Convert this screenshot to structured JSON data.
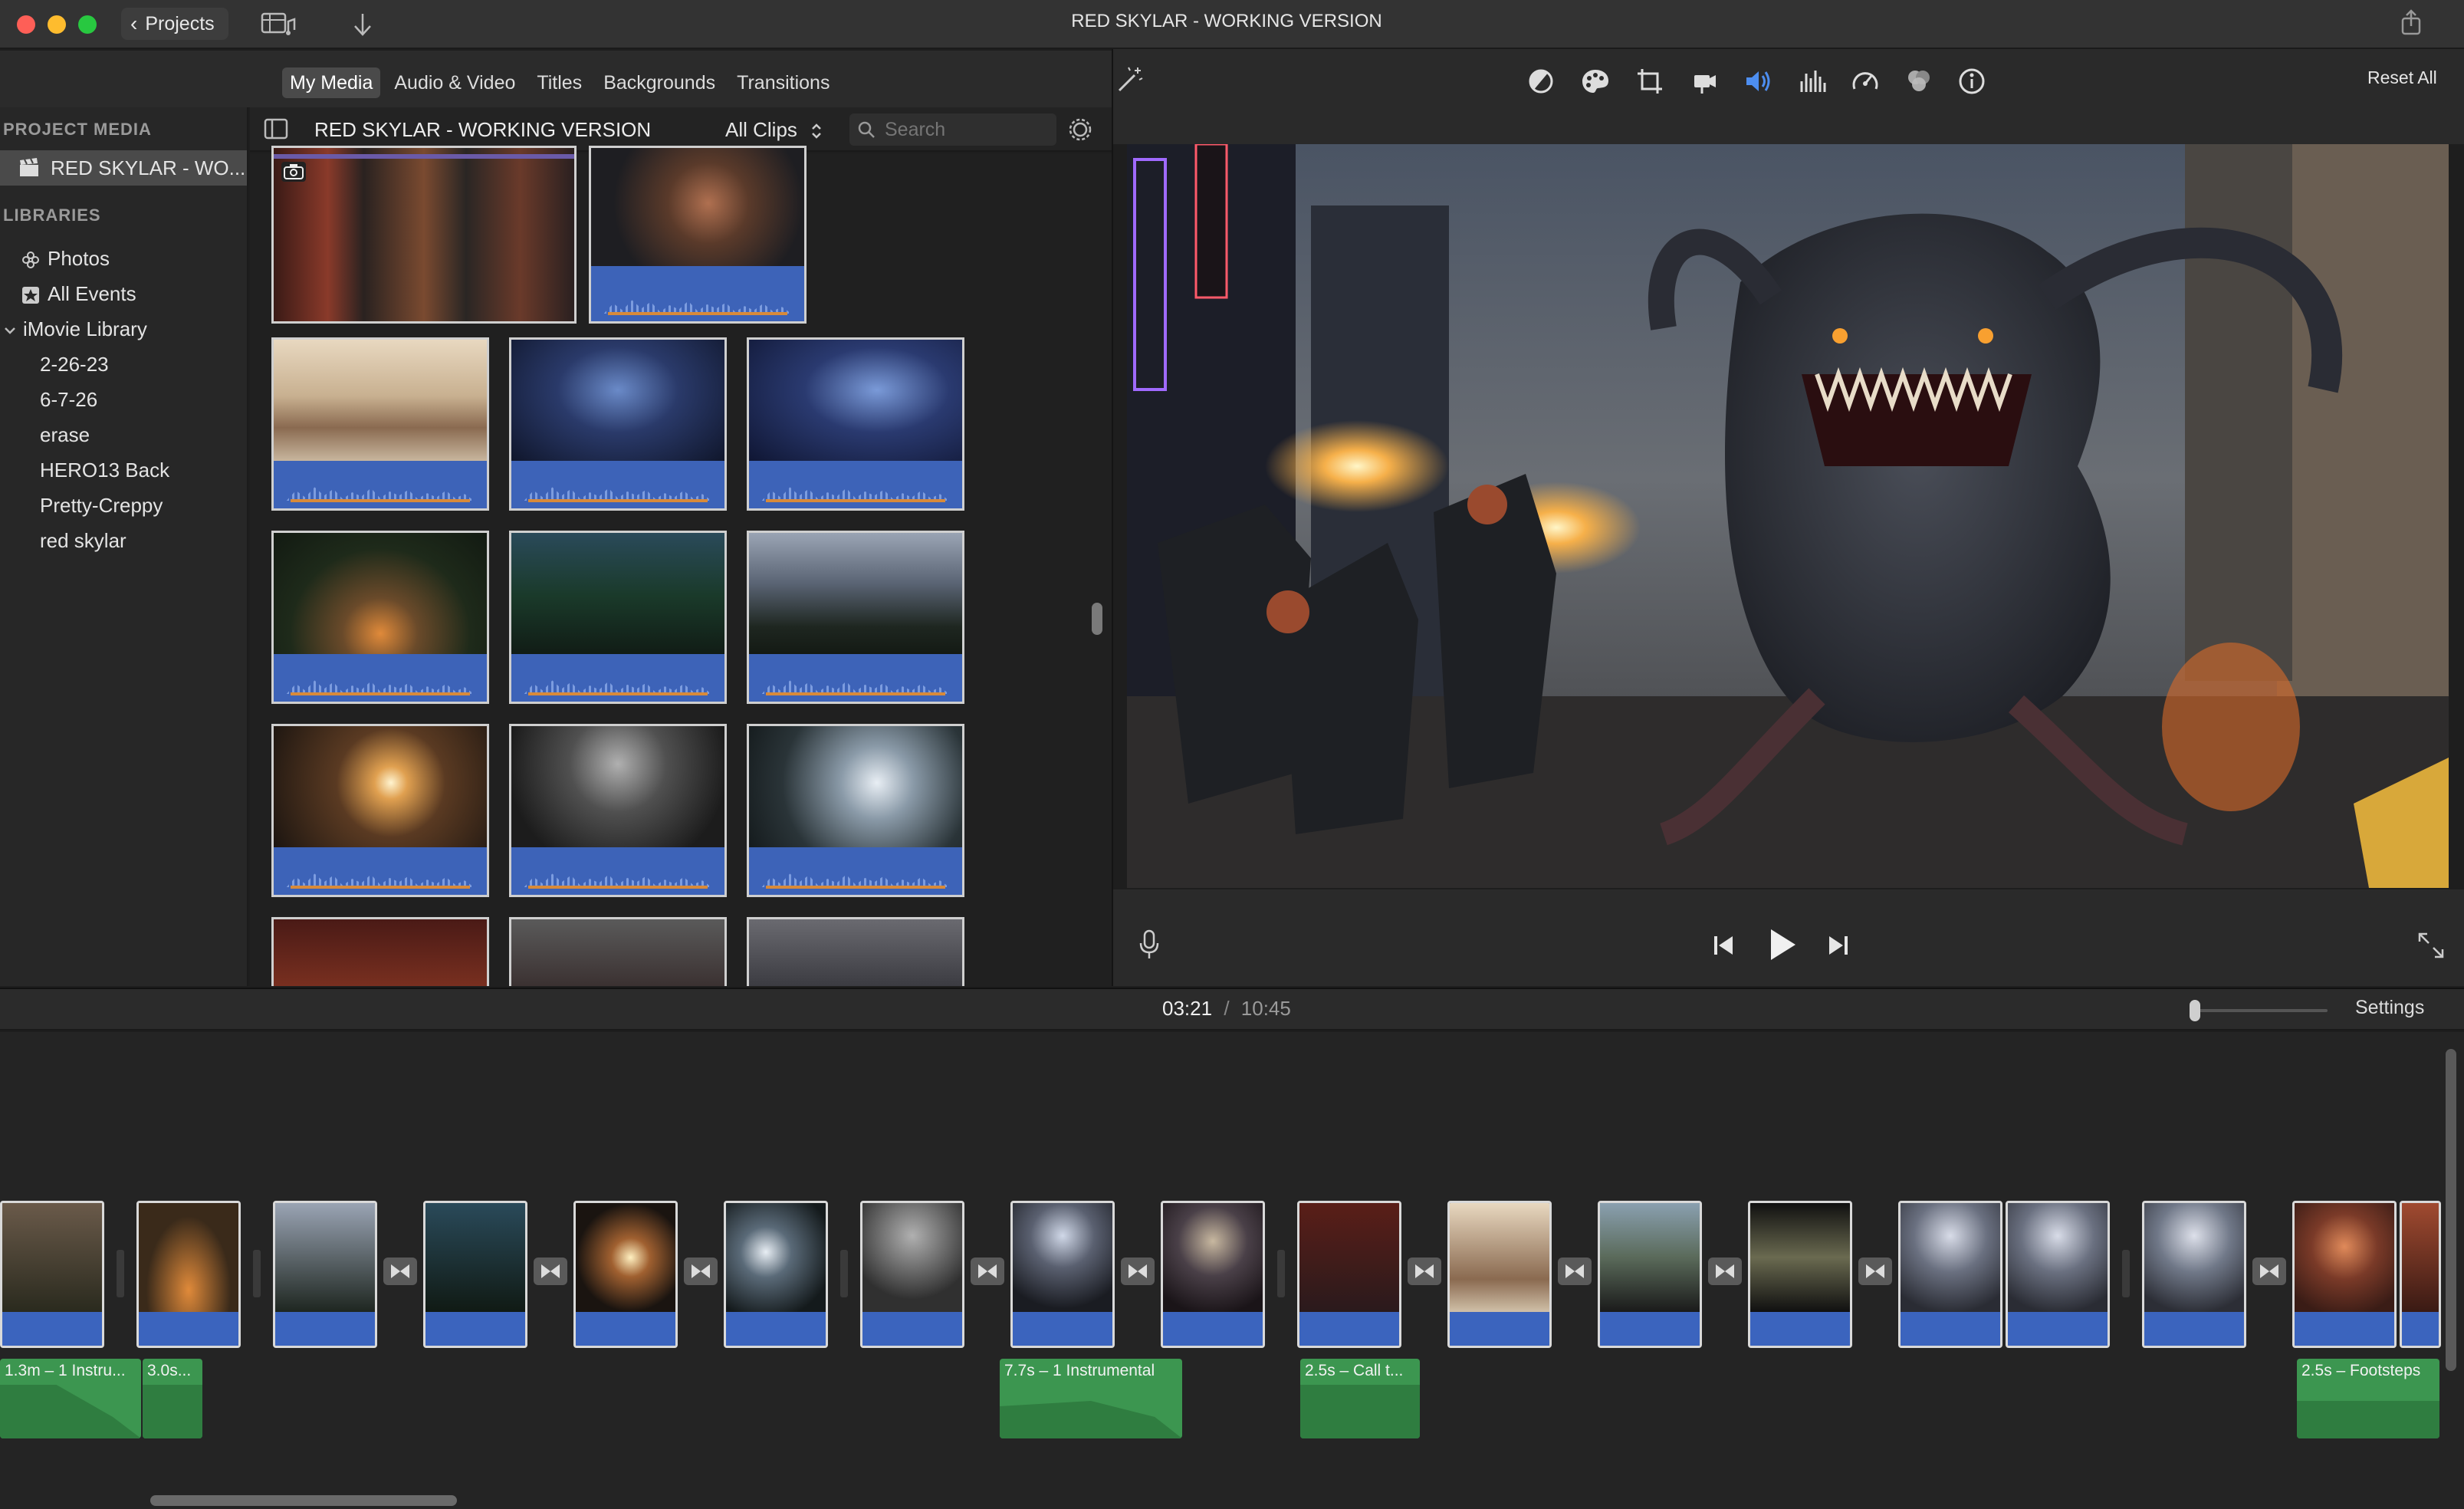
{
  "window": {
    "title": "RED SKYLAR - WORKING VERSION"
  },
  "titlebar": {
    "projects_label": "Projects"
  },
  "media_tabs": [
    "My Media",
    "Audio & Video",
    "Titles",
    "Backgrounds",
    "Transitions"
  ],
  "viewer": {
    "reset_all_label": "Reset All"
  },
  "sidebar": {
    "project_media_heading": "PROJECT MEDIA",
    "project_item": "RED SKYLAR - WO...",
    "libraries_heading": "LIBRARIES",
    "libraries": [
      "Photos",
      "All Events"
    ],
    "imovie_library_label": "iMovie Library",
    "events": [
      "2-26-23",
      "6-7-26",
      "erase",
      "HERO13 Back",
      "Pretty-Creppy",
      "red skylar"
    ]
  },
  "browser": {
    "title": "RED SKYLAR - WORKING VERSION",
    "filter": "All Clips",
    "search_placeholder": "Search"
  },
  "timeline": {
    "current_time": "03:21",
    "separator": "/",
    "total_time": "10:45",
    "settings_label": "Settings",
    "audio_clips": [
      "1.3m – 1 Instru...",
      "3.0s...",
      "7.7s – 1 Instrumental",
      "2.5s – Call t...",
      "2.5s – Footsteps"
    ]
  },
  "colors": {
    "accent_blue": "#3d63b8",
    "audio_green": "#3c9650",
    "selection_orange": "#d88a3a",
    "close": "#fe5f57",
    "minimize": "#febc2e",
    "maximize": "#28c840"
  },
  "icons": {
    "toolbar_left": [
      "projects-chevron-icon",
      "media-view-toggle-icon",
      "import-arrow-icon"
    ],
    "viewer_tools": [
      "magic-wand-icon",
      "color-balance-icon",
      "color-palette-icon",
      "crop-icon",
      "stabilization-camera-icon",
      "volume-icon",
      "equalizer-icon",
      "speed-gauge-icon",
      "clip-filter-icon",
      "info-icon"
    ],
    "viewer_controls": [
      "microphone-icon",
      "skip-back-icon",
      "play-icon",
      "skip-forward-icon",
      "fullscreen-icon"
    ]
  }
}
